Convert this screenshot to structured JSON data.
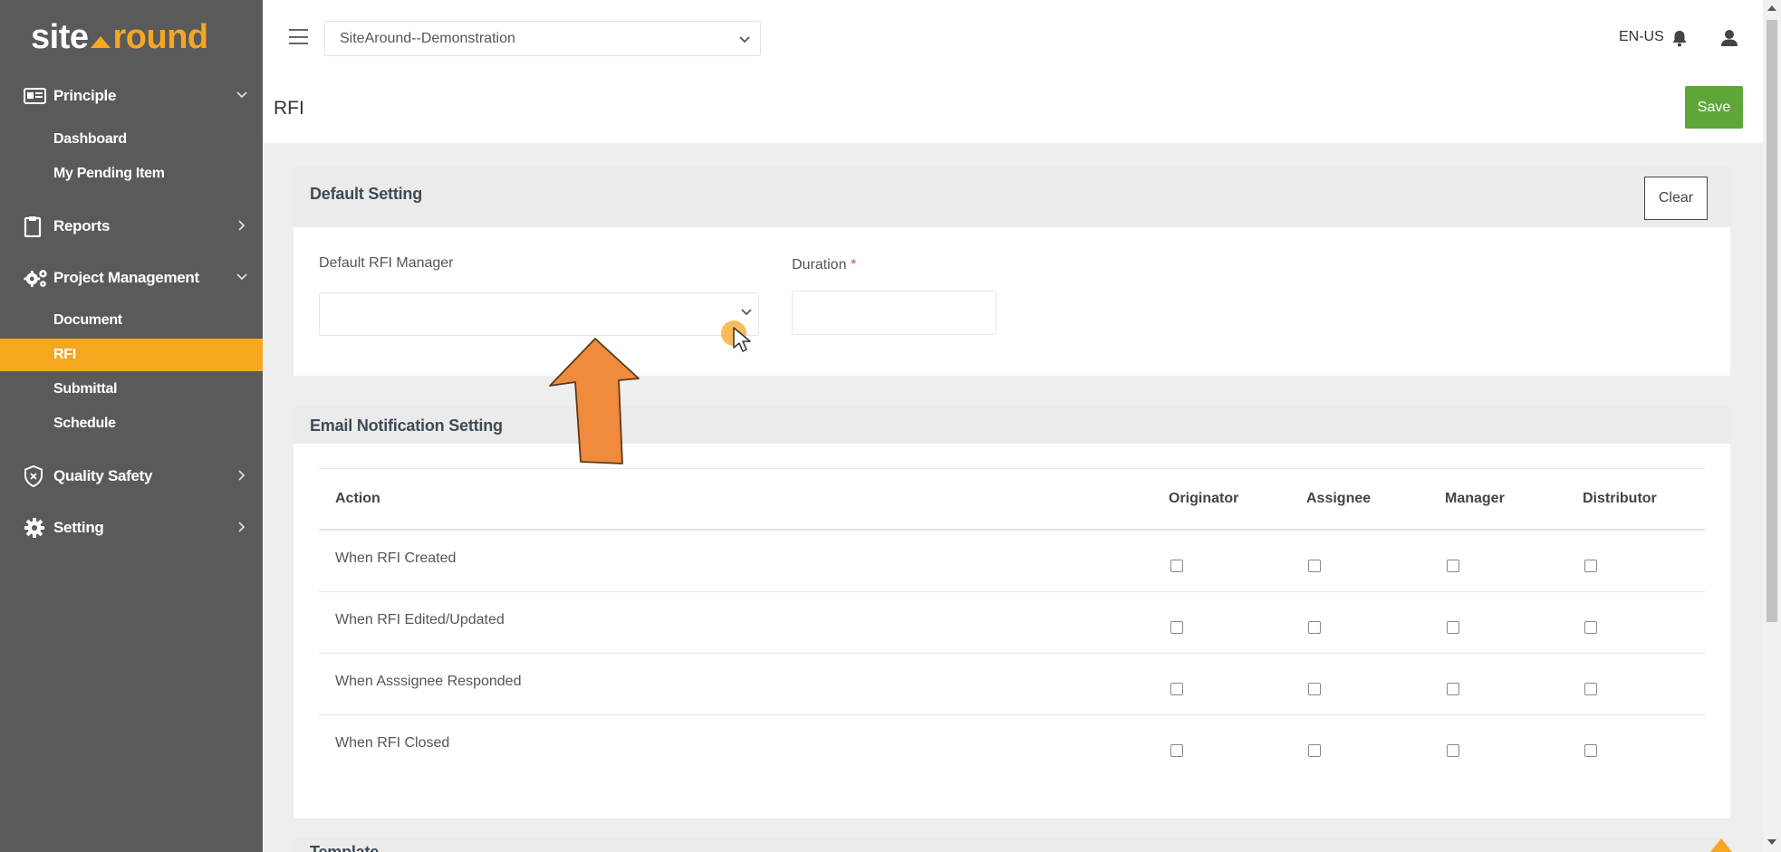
{
  "brand": {
    "part1": "site",
    "part2": "round"
  },
  "sidebar": {
    "groups": [
      {
        "label": "Principle",
        "subitems": [
          "Dashboard",
          "My Pending Item"
        ]
      },
      {
        "label": "Reports"
      },
      {
        "label": "Project Management",
        "subitems": [
          "Document",
          "RFI",
          "Submittal",
          "Schedule"
        ]
      },
      {
        "label": "Quality Safety"
      },
      {
        "label": "Setting"
      }
    ],
    "active_item": "RFI"
  },
  "topbar": {
    "project": "SiteAround--Demonstration",
    "language": "EN-US"
  },
  "page": {
    "title": "RFI",
    "save_label": "Save"
  },
  "default_setting": {
    "title": "Default Setting",
    "clear_label": "Clear",
    "manager_label": "Default RFI Manager",
    "manager_value": "",
    "duration_label": "Duration",
    "duration_required": "*",
    "duration_value": ""
  },
  "email_notification": {
    "title": "Email Notification Setting",
    "columns": [
      "Action",
      "Originator",
      "Assignee",
      "Manager",
      "Distributor"
    ],
    "rows": [
      {
        "action": "When RFI Created",
        "checks": [
          false,
          false,
          false,
          false
        ]
      },
      {
        "action": "When RFI Edited/Updated",
        "checks": [
          false,
          false,
          false,
          false
        ]
      },
      {
        "action": "When Asssignee Responded",
        "checks": [
          false,
          false,
          false,
          false
        ]
      },
      {
        "action": "When RFI Closed",
        "checks": [
          false,
          false,
          false,
          false
        ]
      }
    ]
  },
  "template": {
    "title": "Template"
  },
  "colors": {
    "accent": "#f5a81e",
    "sidebar_bg": "#5a5a5a",
    "save_green": "#5ea63a",
    "arrow_orange": "#f08a3c"
  }
}
